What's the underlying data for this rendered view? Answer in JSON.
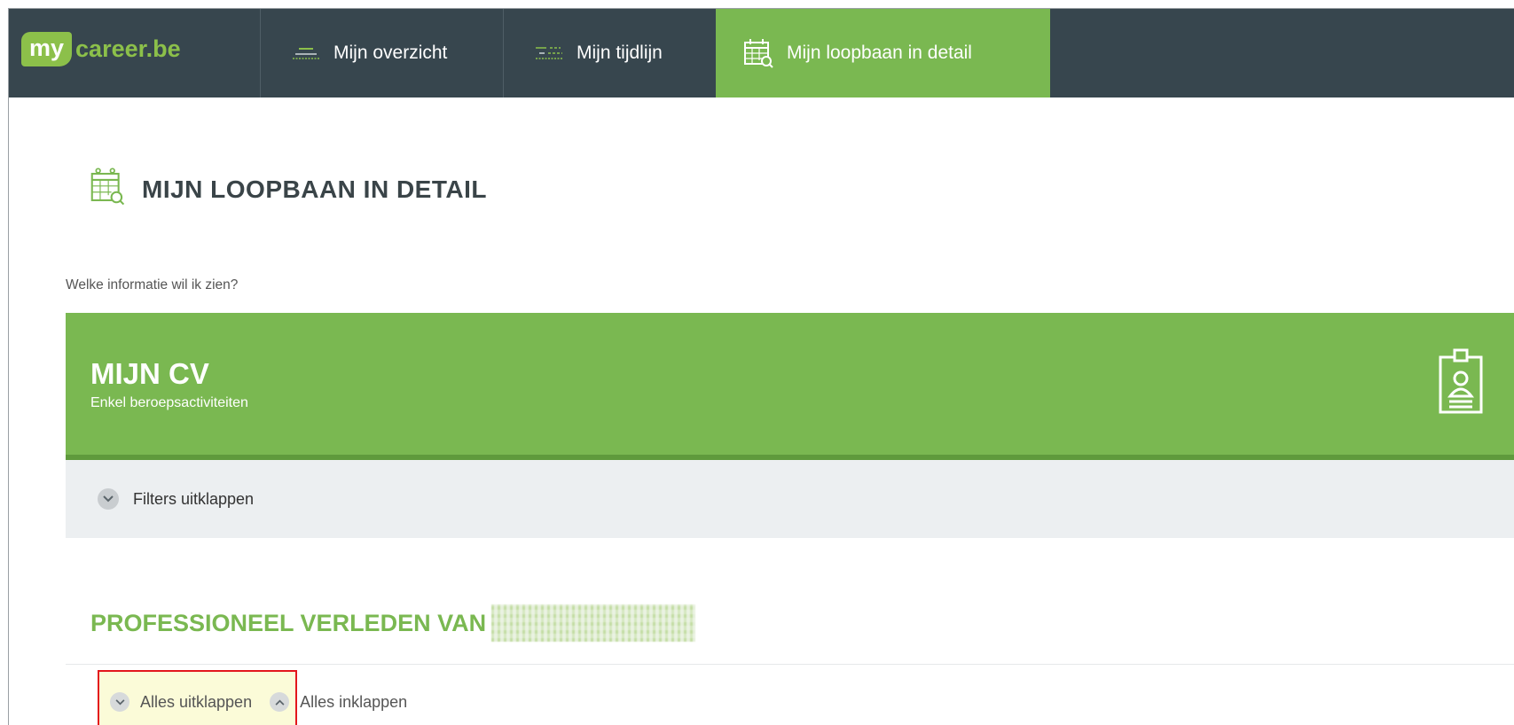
{
  "brand": {
    "logo_my": "my",
    "logo_rest": "career.be",
    "accent_color": "#7ab851",
    "dark_color": "#37464e"
  },
  "nav": {
    "tabs": [
      {
        "label": "Mijn overzicht",
        "icon": "overview-lines-icon",
        "active": false
      },
      {
        "label": "Mijn tijdlijn",
        "icon": "timeline-icon",
        "active": false
      },
      {
        "label": "Mijn loopbaan in detail",
        "icon": "calendar-search-icon",
        "active": true
      }
    ]
  },
  "page": {
    "title": "MIJN LOOPBAAN IN DETAIL",
    "title_icon": "calendar-search-icon",
    "question": "Welke informatie wil ik zien?"
  },
  "cv_card": {
    "title": "MIJN CV",
    "subtitle": "Enkel beroepsactiviteiten",
    "icon": "id-badge-icon"
  },
  "filters": {
    "label": "Filters uitklappen",
    "icon": "chevron-down-icon"
  },
  "section": {
    "title": "PROFESSIONEEL VERLEDEN VAN"
  },
  "expand_controls": {
    "expand_all": "Alles uitklappen",
    "collapse_all": "Alles inklappen"
  }
}
